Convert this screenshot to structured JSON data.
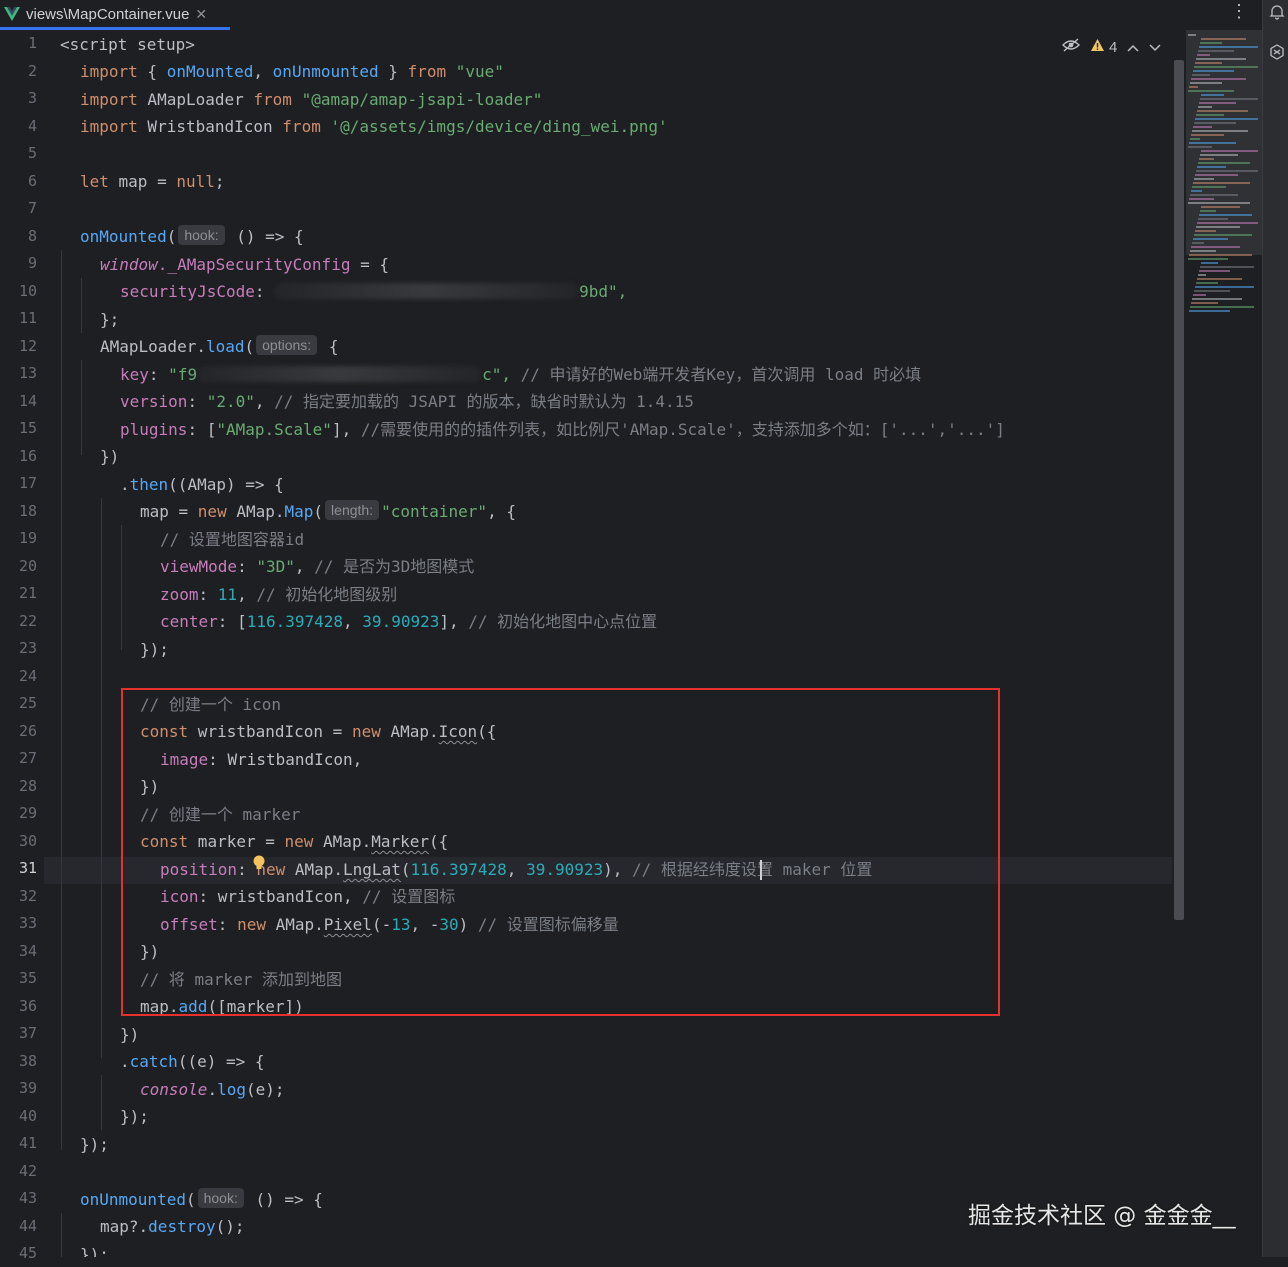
{
  "tab": {
    "title": "views\\MapContainer.vue",
    "close_symbol": "✕",
    "icon": "vue-logo-icon"
  },
  "toolbar": {
    "more_symbol": "⋮"
  },
  "inspection": {
    "warning_count": "4",
    "icons": [
      "eye-off-icon",
      "warning-icon",
      "chevron-up-icon",
      "chevron-down-icon"
    ]
  },
  "line_numbers": [
    "1",
    "2",
    "3",
    "4",
    "5",
    "6",
    "7",
    "8",
    "9",
    "10",
    "11",
    "12",
    "13",
    "14",
    "15",
    "16",
    "17",
    "18",
    "19",
    "20",
    "21",
    "22",
    "23",
    "24",
    "25",
    "26",
    "27",
    "28",
    "29",
    "30",
    "31",
    "32",
    "33",
    "34",
    "35",
    "36",
    "37",
    "38",
    "39",
    "40",
    "41",
    "42",
    "43",
    "44",
    "45"
  ],
  "current_line": "31",
  "code": {
    "l1": [
      "<script setup>"
    ],
    "l2": [
      "import",
      " { ",
      "onMounted",
      ", ",
      "onUnmounted",
      " } ",
      "from",
      " ",
      "\"vue\""
    ],
    "l3": [
      "import",
      " AMapLoader ",
      "from",
      " ",
      "\"@amap/amap-jsapi-loader\""
    ],
    "l4": [
      "import",
      " WristbandIcon ",
      "from",
      " ",
      "'@/assets/imgs/device/ding_wei.png'"
    ],
    "l6": [
      "let",
      " map = ",
      "null",
      ";"
    ],
    "l8": [
      "onMounted",
      "(",
      "hook:",
      " () => {"
    ],
    "l9": [
      "window",
      "._AMapSecurityConfig",
      " = {"
    ],
    "l10": [
      "securityJsCode",
      ": ",
      "9bd\","
    ],
    "l11": [
      "};"
    ],
    "l12": [
      "AMapLoader.",
      "load",
      "(",
      "options:",
      " {"
    ],
    "l13": [
      "key",
      ": ",
      "\"f9",
      "c\",",
      " // 申请好的Web端开发者Key，首次调用 load 时必填"
    ],
    "l14": [
      "version",
      ": ",
      "\"2.0\"",
      ", ",
      "// 指定要加载的 JSAPI 的版本，缺省时默认为 1.4.15"
    ],
    "l15": [
      "plugins",
      ": [",
      "\"AMap.Scale\"",
      "], ",
      "//需要使用的的插件列表，如比例尺'AMap.Scale'，支持添加多个如：['...','...']"
    ],
    "l16": [
      "})"
    ],
    "l17": [
      ".",
      "then",
      "((AMap) => {"
    ],
    "l18": [
      "map = ",
      "new",
      " AMap.",
      "Map",
      "(",
      "length:",
      "\"container\"",
      ", {"
    ],
    "l19": [
      "// 设置地图容器id"
    ],
    "l20": [
      "viewMode",
      ": ",
      "\"3D\"",
      ", ",
      "// 是否为3D地图模式"
    ],
    "l21": [
      "zoom",
      ": ",
      "11",
      ", ",
      "// 初始化地图级别"
    ],
    "l22": [
      "center",
      ": [",
      "116.397428",
      ", ",
      "39.90923",
      "], ",
      "// 初始化地图中心点位置"
    ],
    "l23": [
      "});"
    ],
    "l25": [
      "// 创建一个 icon"
    ],
    "l26": [
      "const",
      " wristbandIcon = ",
      "new",
      " AMap.",
      "Icon",
      "({"
    ],
    "l27": [
      "image",
      ": WristbandIcon,"
    ],
    "l28": [
      "})"
    ],
    "l29": [
      "// 创建一个 marker"
    ],
    "l30": [
      "const",
      " marker = ",
      "new",
      " AMap.",
      "Marker",
      "({"
    ],
    "l31": [
      "position",
      ": ",
      "new",
      " AMap.",
      "LngLat",
      "(",
      "116.397428",
      ", ",
      "39.90923",
      "), ",
      "// 根据经纬度设置 maker 位置"
    ],
    "l32": [
      "icon",
      ": wristbandIcon, ",
      "// 设置图标"
    ],
    "l33": [
      "offset",
      ": ",
      "new",
      " AMap.",
      "Pixel",
      "(-",
      "13",
      ", -",
      "30",
      ") ",
      "// 设置图标偏移量"
    ],
    "l34": [
      "})"
    ],
    "l35": [
      "// 将 marker 添加到地图"
    ],
    "l36": [
      "map.",
      "add",
      "([marker])"
    ],
    "l37": [
      "})"
    ],
    "l38": [
      ".",
      "catch",
      "((e) => {"
    ],
    "l39": [
      "console",
      ".",
      "log",
      "(e);"
    ],
    "l40": [
      "});"
    ],
    "l41": [
      "});"
    ],
    "l43": [
      "onUnmounted",
      "(",
      "hook:",
      " () => {"
    ],
    "l44": [
      "map?.",
      "destroy",
      "();"
    ],
    "l45": [
      "});"
    ]
  },
  "watermark": "掘金技术社区 @ 金金金__",
  "colors": {
    "background": "#1e1f22",
    "keyword": "#cf8e6d",
    "function": "#56a8f5",
    "string": "#6aab73",
    "number": "#2aacb8",
    "comment": "#7a7e85",
    "property": "#c77dbb",
    "highlight_box": "#e5312c",
    "tab_underline": "#3574f0"
  }
}
